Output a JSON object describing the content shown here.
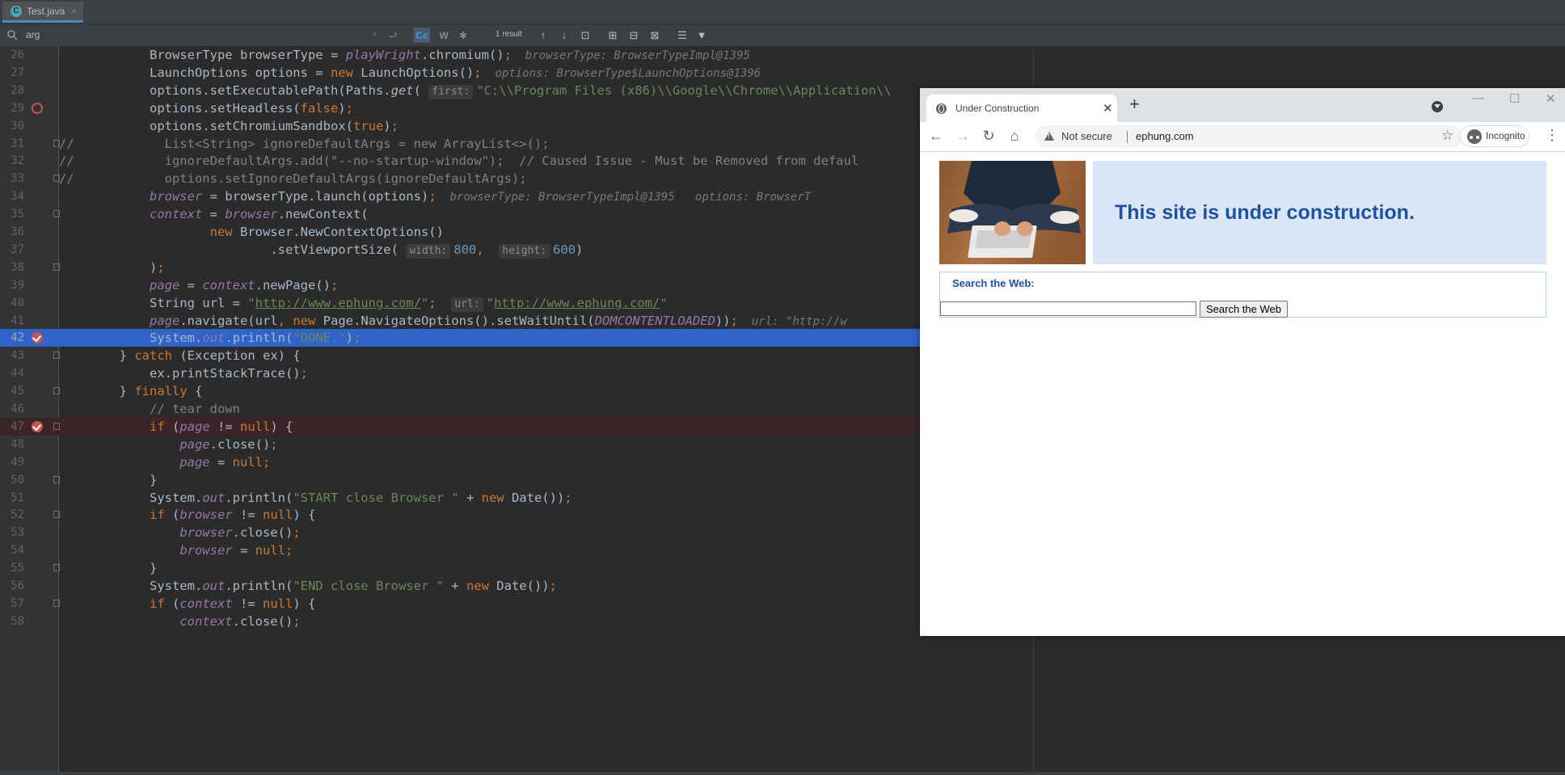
{
  "ide": {
    "tab_label": "Test.java",
    "tab_close": "×",
    "java_icon_glyph": "C",
    "find": {
      "query": "arg",
      "clear_glyph": "×",
      "regex_glyph": "⮐",
      "case_label": "Cc",
      "words_label": "W",
      "regex_opt_label": "✱",
      "result": "1 result",
      "tools": [
        "↑",
        "↓",
        "⊡",
        "⊞",
        "⊟",
        "⊠",
        "☰",
        "▼"
      ]
    },
    "lines": [
      {
        "n": "26",
        "text": "            BrowserType browserType = playWright.chromium();  browserType: BrowserTypeImpl@1395"
      },
      {
        "n": "27",
        "text": "            LaunchOptions options = new LaunchOptions();  options: BrowserType$LaunchOptions@1396"
      },
      {
        "n": "28",
        "text": "            options.setExecutablePath(Paths.get( first: \"C:\\\\Program Files (x86)\\\\Google\\\\Chrome\\\\Application\\\\"
      },
      {
        "n": "29",
        "text": "            options.setHeadless(false);"
      },
      {
        "n": "30",
        "text": "            options.setChromiumSandbox(true);"
      },
      {
        "n": "31",
        "text": "//            List<String> ignoreDefaultArgs = new ArrayList<>();"
      },
      {
        "n": "32",
        "text": "//            ignoreDefaultArgs.add(\"--no-startup-window\");  // Caused Issue - Must be Removed from defaul"
      },
      {
        "n": "33",
        "text": "//            options.setIgnoreDefaultArgs(ignoreDefaultArgs);"
      },
      {
        "n": "34",
        "text": "            browser = browserType.launch(options);  browserType: BrowserTypeImpl@1395   options: BrowserT"
      },
      {
        "n": "35",
        "text": "            context = browser.newContext("
      },
      {
        "n": "36",
        "text": "                    new Browser.NewContextOptions()"
      },
      {
        "n": "37",
        "text": "                            .setViewportSize( width: 800,  height: 600)"
      },
      {
        "n": "38",
        "text": "            );"
      },
      {
        "n": "39",
        "text": "            page = context.newPage();"
      },
      {
        "n": "40",
        "text": "            String url = \"http://www.ephung.com/\";  url: \"http://www.ephung.com/\""
      },
      {
        "n": "41",
        "text": "            page.navigate(url, new Page.NavigateOptions().setWaitUntil(DOMCONTENTLOADED));  url: \"http://w"
      },
      {
        "n": "42",
        "text": "            System.out.println(\"DONE.\");"
      },
      {
        "n": "43",
        "text": "        } catch (Exception ex) {"
      },
      {
        "n": "44",
        "text": "            ex.printStackTrace();"
      },
      {
        "n": "45",
        "text": "        } finally {"
      },
      {
        "n": "46",
        "text": "            // tear down"
      },
      {
        "n": "47",
        "text": "            if (page != null) {"
      },
      {
        "n": "48",
        "text": "                page.close();"
      },
      {
        "n": "49",
        "text": "                page = null;"
      },
      {
        "n": "50",
        "text": "            }"
      },
      {
        "n": "51",
        "text": "            System.out.println(\"START close Browser \" + new Date());"
      },
      {
        "n": "52",
        "text": "            if (browser != null) {"
      },
      {
        "n": "53",
        "text": "                browser.close();"
      },
      {
        "n": "54",
        "text": "                browser = null;"
      },
      {
        "n": "55",
        "text": "            }"
      },
      {
        "n": "56",
        "text": "            System.out.println(\"END close Browser \" + new Date());"
      },
      {
        "n": "57",
        "text": "            if (context != null) {"
      },
      {
        "n": "58",
        "text": "                context.close();"
      }
    ],
    "current_line": "42",
    "breakpoint_lines": [
      "29",
      "42",
      "47"
    ],
    "colors": {
      "keyword": "#cc7832",
      "field": "#9876aa",
      "string": "#6a8759",
      "number": "#6897bb",
      "comment": "#808080",
      "current_line": "#2f65ca",
      "breakpoint": "#c75450"
    }
  },
  "browser": {
    "tab_title": "Under Construction",
    "tab_close": "✕",
    "new_tab": "+",
    "window_controls": [
      "—",
      "☐",
      "✕"
    ],
    "nav": {
      "back": "←",
      "forward": "→",
      "reload": "↻",
      "home": "⌂"
    },
    "security_label": "Not secure",
    "address": "ephung.com",
    "star": "☆",
    "profile_label": "Incognito",
    "menu": "⋮",
    "page": {
      "heading": "This site is under construction.",
      "search_title": "Search the Web:",
      "search_button": "Search the Web",
      "search_value": ""
    }
  }
}
